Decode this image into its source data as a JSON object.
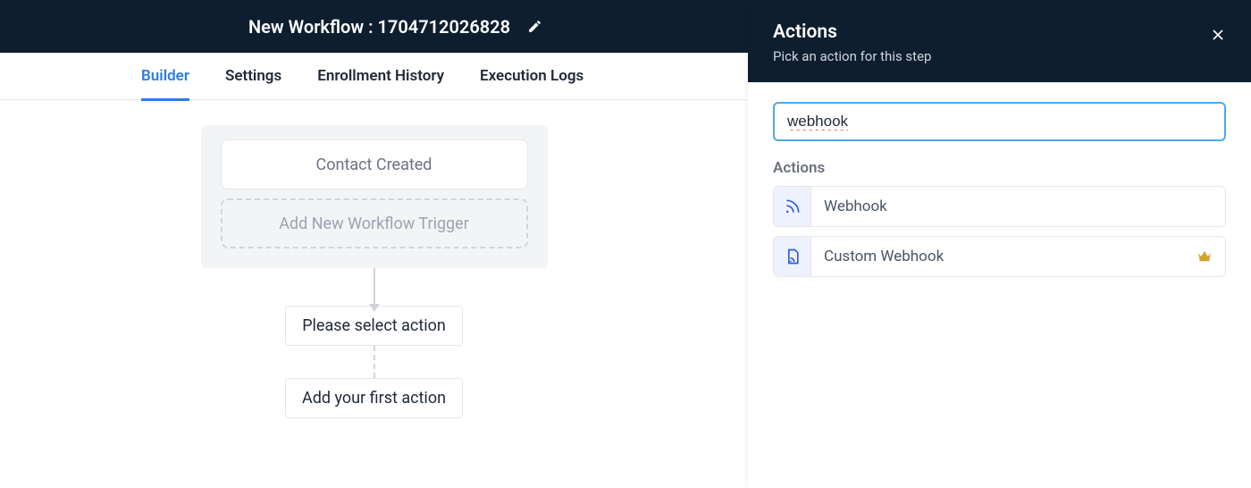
{
  "header": {
    "title": "New Workflow : 1704712026828"
  },
  "tabs": [
    "Builder",
    "Settings",
    "Enrollment History",
    "Execution Logs"
  ],
  "active_tab_index": 0,
  "canvas": {
    "trigger_card": "Contact Created",
    "add_trigger": "Add New Workflow Trigger",
    "select_action": "Please select action",
    "add_first_action": "Add your first action"
  },
  "panel": {
    "title": "Actions",
    "subtitle": "Pick an action for this step",
    "search_value": "webhook",
    "section_label": "Actions",
    "items": [
      {
        "label": "Webhook",
        "icon": "rss",
        "premium": false
      },
      {
        "label": "Custom Webhook",
        "icon": "doc-rss",
        "premium": true
      }
    ]
  }
}
